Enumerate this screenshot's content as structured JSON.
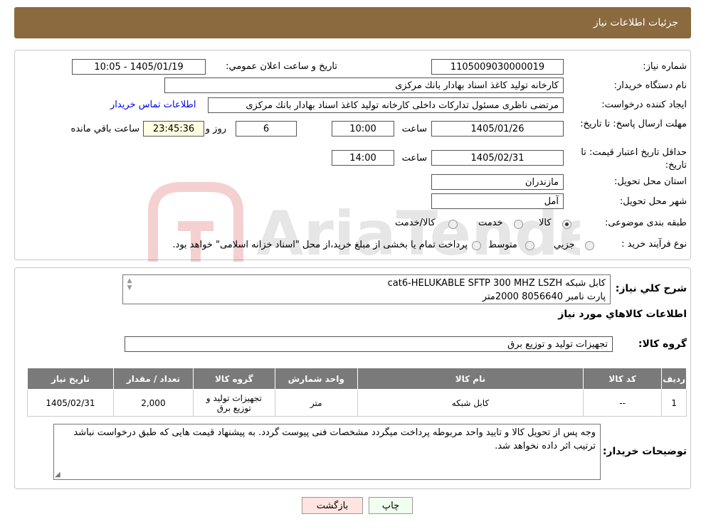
{
  "header": {
    "title": "جزئیات اطلاعات نیاز"
  },
  "form": {
    "need_number_label": "شماره نیاز:",
    "need_number": "1105009030000019",
    "announce_label": "تاریخ و ساعت اعلان عمومي:",
    "announce_value": "1405/01/19 - 10:05",
    "buyer_label": "نام دستگاه خريدار:",
    "buyer_value": "كارخانه توليد كاغذ اسناد بهادار بانك مركزی",
    "creator_label": "ایجاد کننده درخواست:",
    "creator_value": "مرتضی ناظری مسئول تداركات داخلی كارخانه توليد كاغذ اسناد بهادار بانك مركزی",
    "contact_link": "اطلاعات تماس خريدار",
    "deadline_label": "مهلت ارسال پاسخ: تا تاریخ:",
    "deadline_date": "1405/01/26",
    "time_label": "ساعت",
    "deadline_time": "10:00",
    "days_value": "6",
    "days_label": "روز و",
    "remaining_value": "23:45:36",
    "remaining_label": "ساعت باقي مانده",
    "validity_label": "حداقل تاريخ اعتبار قيمت: تا تاریخ:",
    "validity_date": "1405/02/31",
    "validity_time": "14:00",
    "province_label": "استان محل تحويل:",
    "province_value": "مازندران",
    "city_label": "شهر محل تحويل:",
    "city_value": "آمل",
    "category_label": "طبقه بندی موضوعی:",
    "category_options": [
      "كالا",
      "خدمت",
      "كالا/خدمت"
    ],
    "process_label": "نوع فرآیند خرید :",
    "process_options": [
      "جزيي",
      "متوسط"
    ],
    "process_note": "پرداخت تمام یا بخشی از مبلغ خرید،از محل \"اسناد خزانه اسلامی\" خواهد بود."
  },
  "description": {
    "label": "شرح کلي نياز:",
    "line1": "كابل شبكه cat6-HELUKABLE SFTP 300 MHZ LSZH",
    "line2": "پارت نامبر 8056640       2000متر"
  },
  "goods": {
    "title": "اطلاعات كالاهاي مورد نياز",
    "group_label": "گروه کالا:",
    "group_value": "تجهيزات توليد و توزيع برق"
  },
  "table": {
    "headers": [
      "رديف",
      "کد کالا",
      "نام کالا",
      "واحد شمارش",
      "گروه کالا",
      "تعداد / مقدار",
      "تاریخ نیاز"
    ],
    "rows": [
      [
        "1",
        "--",
        "كابل شبكه",
        "متر",
        "تجهيزات توليد و توزيع برق",
        "2,000",
        "1405/02/31"
      ]
    ]
  },
  "notes": {
    "label": "توضيحات خريدار:",
    "text": "وجه پس از تحويل كالا و تاييد واحد مربوطه پرداخت ميگردد مشخصات فنی پيوست گردد. به پيشنهاد قيمت هايی كه طبق درخواست نباشد ترتيب اثر داده نخواهد شد."
  },
  "buttons": {
    "print": "چاپ",
    "back": "بازگشت"
  },
  "watermark": {
    "text": "AriaTender.neT"
  },
  "colors": {
    "header_bg": "#8b6a3f",
    "table_header_bg": "#7a7a7a",
    "link": "#0000ee",
    "back_btn_bg": "#ffe4e1",
    "print_btn_bg": "#f0fff0"
  }
}
